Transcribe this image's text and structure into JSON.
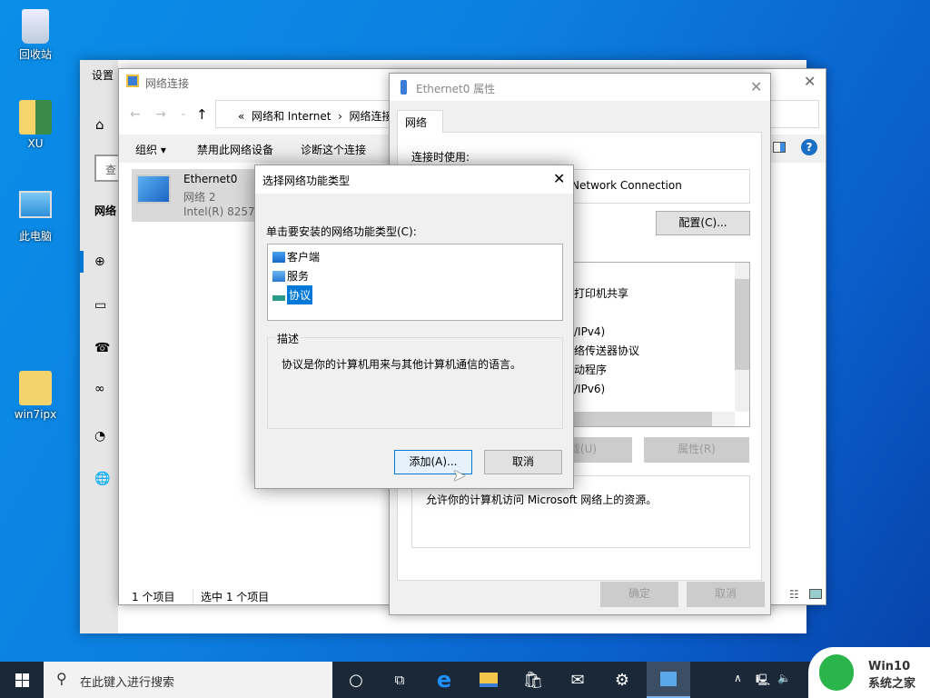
{
  "desktop": {
    "icons": [
      {
        "label": "回收站"
      },
      {
        "label": "XU"
      },
      {
        "label": "此电脑"
      },
      {
        "label": "win7ipx"
      }
    ]
  },
  "settings": {
    "title": "设置",
    "search_placeholder": "查",
    "section": "网络"
  },
  "explorer": {
    "title": "网络连接",
    "breadcrumb": [
      "«",
      "网络和 Internet",
      "网络连接"
    ],
    "toolbar": [
      "组织 ▾",
      "禁用此网络设备",
      "诊断这个连接"
    ],
    "item": {
      "name": "Ethernet0",
      "network": "网络 2",
      "adapter": "Intel(R) 82574"
    },
    "status": {
      "count": "1 个项目",
      "selected": "选中 1 个项目"
    }
  },
  "props": {
    "title": "Ethernet0 属性",
    "tab": "网络",
    "connect_using": "连接时使用:",
    "adapter": "Network Connection",
    "configure": "配置(C)...",
    "components": [
      "打印机共享",
      "/IPv4)",
      "络传送器协议",
      "动程序",
      "/IPv6)"
    ],
    "uninstall": "载(U)",
    "properties": "属性(R)",
    "description": "允许你的计算机访问 Microsoft 网络上的资源。",
    "ok": "确定",
    "cancel": "取消"
  },
  "dialog": {
    "title": "选择网络功能类型",
    "prompt": "单击要安装的网络功能类型(C):",
    "items": [
      "客户端",
      "服务",
      "协议"
    ],
    "selected_index": 2,
    "desc_label": "描述",
    "desc": "协议是你的计算机用来与其他计算机通信的语言。",
    "add": "添加(A)...",
    "cancel": "取消"
  },
  "taskbar": {
    "search_placeholder": "在此键入进行搜索",
    "watermark": {
      "line1": "Win10",
      "line2": "系统之家"
    }
  },
  "colors": {
    "accent": "#0078d7",
    "selection": "#0078d7",
    "taskbar": "#1b2837"
  }
}
